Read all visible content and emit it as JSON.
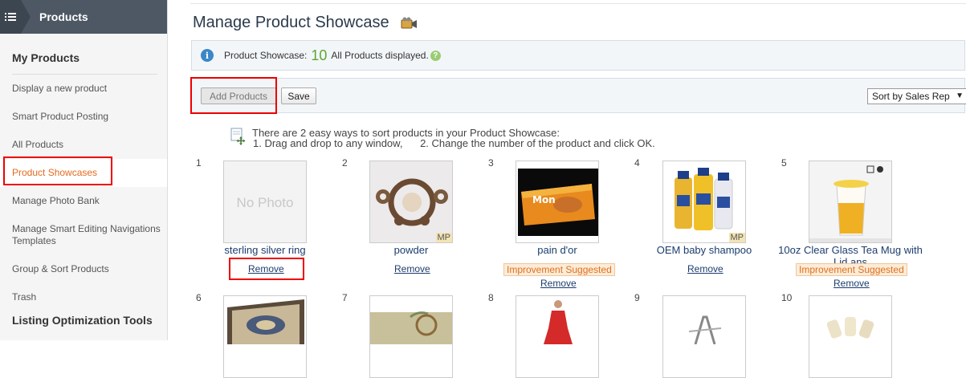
{
  "sidebar": {
    "header": "Products",
    "section1": "My Products",
    "items": [
      {
        "label": "Display a new product"
      },
      {
        "label": "Smart Product Posting"
      },
      {
        "label": "All Products"
      },
      {
        "label": "Product Showcases"
      },
      {
        "label": "Manage Photo Bank"
      },
      {
        "label": "Manage Smart Editing Navigations Templates"
      },
      {
        "label": "Group & Sort Products"
      },
      {
        "label": "Trash"
      }
    ],
    "section2": "Listing Optimization Tools"
  },
  "main": {
    "title": "Manage Product Showcase",
    "info": {
      "prefix": "Product Showcase:",
      "count": "10",
      "suffix": "All Products displayed.",
      "help": "?"
    },
    "toolbar": {
      "add_label": "Add Products",
      "save_label": "Save",
      "sort_label": "Sort by Sales Rep"
    },
    "tip": {
      "line1": "There are 2 easy ways to sort products in your Product Showcase:",
      "way1": "1. Drag and drop to any window,",
      "way2": "2. Change the number of the product and click OK."
    },
    "products": [
      {
        "num": "1",
        "name": "sterling silver ring",
        "photo": "No Photo",
        "remove": "Remove"
      },
      {
        "num": "2",
        "name": "powder",
        "badge": "MP",
        "remove": "Remove"
      },
      {
        "num": "3",
        "name": "pain d'or",
        "improve": "Improvement Suggested",
        "remove": "Remove",
        "pack_text": "Mon"
      },
      {
        "num": "4",
        "name": "OEM baby shampoo",
        "badge": "MP",
        "remove": "Remove"
      },
      {
        "num": "5",
        "name": "10oz Clear Glass Tea Mug with Lid ans",
        "improve": "Improvement Suggested",
        "remove": "Remove"
      },
      {
        "num": "6"
      },
      {
        "num": "7"
      },
      {
        "num": "8"
      },
      {
        "num": "9"
      },
      {
        "num": "10"
      }
    ]
  },
  "colors": {
    "accent": "#e6691e",
    "highlight": "#ee0000",
    "count_green": "#5aa831",
    "sidebar_header": "#4d5864"
  }
}
